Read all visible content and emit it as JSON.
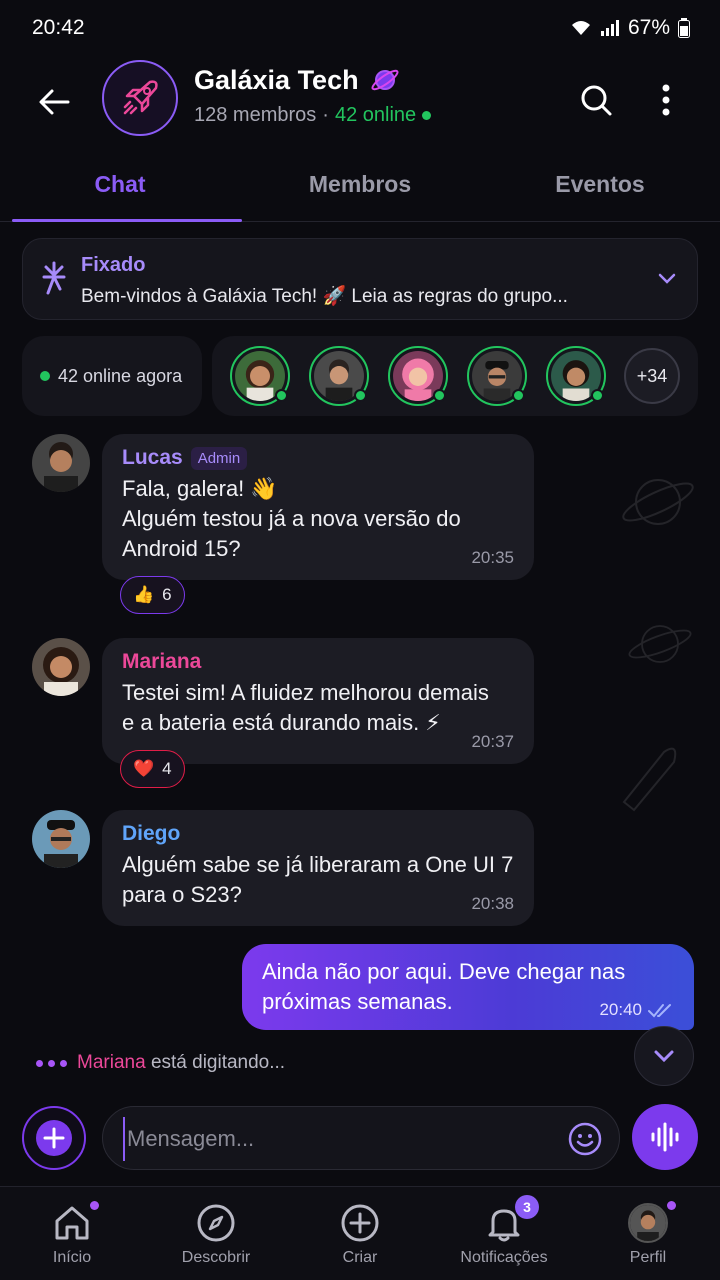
{
  "status": {
    "time": "20:42",
    "battery": "67%"
  },
  "header": {
    "title": "Galáxia Tech",
    "members": "128 membros",
    "separator": "·",
    "online": "42 online"
  },
  "tabs": [
    {
      "label": "Chat",
      "active": true
    },
    {
      "label": "Membros",
      "active": false
    },
    {
      "label": "Eventos",
      "active": false
    }
  ],
  "pinned": {
    "title": "Fixado",
    "text": "Bem-vindos à Galáxia Tech! 🚀 Leia as regras do grupo..."
  },
  "online_bar": {
    "label": "42 online agora",
    "more": "+34"
  },
  "messages": [
    {
      "sender": "Lucas",
      "badge": "Admin",
      "color": "#a78bfa",
      "lines": [
        "Fala, galera! 👋",
        "Alguém testou já a nova versão do",
        "Android 15?"
      ],
      "time": "20:35",
      "reaction": {
        "emoji": "👍",
        "count": "6"
      }
    },
    {
      "sender": "Mariana",
      "color": "#ec4899",
      "lines": [
        "Testei sim! A fluidez melhorou demais",
        "e a bateria está durando mais. ⚡"
      ],
      "time": "20:37",
      "reaction": {
        "emoji": "❤️",
        "count": "4"
      }
    },
    {
      "sender": "Diego",
      "color": "#60a5fa",
      "lines": [
        "Alguém sabe se já liberaram a One UI 7",
        "para o S23?"
      ],
      "time": "20:38"
    }
  ],
  "outgoing": {
    "lines": [
      "Ainda não por aqui. Deve chegar nas",
      "próximas semanas."
    ],
    "time": "20:40"
  },
  "typing": {
    "who": "Mariana",
    "text": "está digitando..."
  },
  "composer": {
    "placeholder": "Mensagem..."
  },
  "bottom_nav": [
    {
      "label": "Início",
      "icon": "home-icon"
    },
    {
      "label": "Descobrir",
      "icon": "compass-icon"
    },
    {
      "label": "Criar",
      "icon": "plus-circle-icon"
    },
    {
      "label": "Notificações",
      "icon": "bell-icon",
      "badge": "3"
    },
    {
      "label": "Perfil",
      "icon": "avatar"
    }
  ],
  "colors": {
    "accent": "#8b5cf6",
    "online": "#22c55e",
    "mention": "#ec4899"
  }
}
